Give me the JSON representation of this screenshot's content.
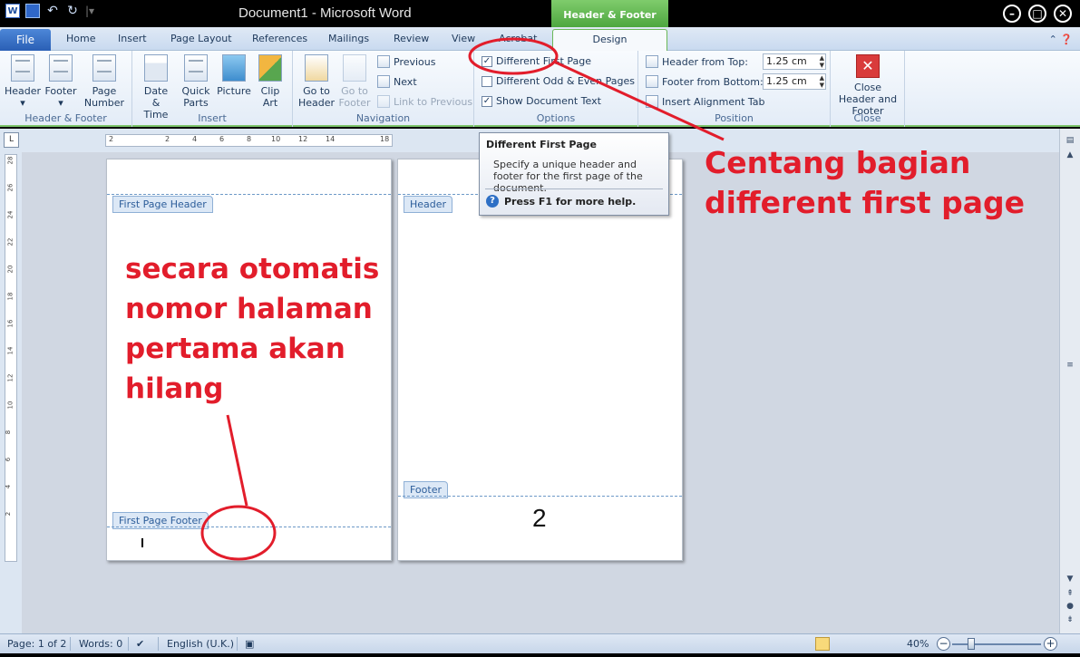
{
  "window": {
    "title": "Document1  -  Microsoft Word",
    "contextual_tab_group": "Header & Footer Tools",
    "controls": [
      "minimize",
      "maximize",
      "close"
    ]
  },
  "qat": {
    "app_icon": "W",
    "icons": [
      "word-icon",
      "save-icon",
      "undo-icon",
      "redo-icon"
    ]
  },
  "tabs": {
    "file": "File",
    "items": [
      "Home",
      "Insert",
      "Page Layout",
      "References",
      "Mailings",
      "Review",
      "View",
      "Acrobat",
      "Design"
    ],
    "active": "Design"
  },
  "ribbon": {
    "header_footer": {
      "header": "Header",
      "footer": "Footer",
      "page_number": "Page Number",
      "label": "Header & Footer"
    },
    "insert": {
      "date_time": "Date & Time",
      "quick_parts": "Quick Parts",
      "picture": "Picture",
      "clip_art": "Clip Art",
      "label": "Insert"
    },
    "navigation": {
      "go_to_header": "Go to Header",
      "go_to_footer": "Go to Footer",
      "previous": "Previous",
      "next": "Next",
      "link_to_previous": "Link to Previous",
      "label": "Navigation"
    },
    "options": {
      "different_first_page": "Different First Page",
      "different_odd_even": "Different Odd & Even Pages",
      "show_document_text": "Show Document Text",
      "label": "Options",
      "checked": [
        true,
        false,
        true
      ]
    },
    "position": {
      "header_from_top": "Header from Top:",
      "header_from_top_value": "1.25 cm",
      "footer_from_bottom": "Footer from Bottom:",
      "footer_from_bottom_value": "1.25 cm",
      "insert_alignment_tab": "Insert Alignment Tab",
      "label": "Position"
    },
    "close": {
      "close_header_footer": "Close Header and Footer",
      "label": "Close"
    }
  },
  "tooltip": {
    "title": "Different First Page",
    "body": "Specify a unique header and footer for the first page of the document.",
    "help": "Press F1 for more help."
  },
  "ruler": {
    "h_ticks": [
      "2",
      "2",
      "4",
      "6",
      "8",
      "10",
      "12",
      "14",
      "18"
    ],
    "v_ticks": [
      "28",
      "26",
      "24",
      "22",
      "20",
      "18",
      "16",
      "14",
      "12",
      "10",
      "8",
      "6",
      "4",
      "2"
    ]
  },
  "pages": {
    "page1": {
      "header_tag": "First Page Header",
      "footer_tag": "First Page Footer"
    },
    "page2": {
      "header_tag": "Header",
      "footer_tag": "Footer",
      "page_number": "2"
    }
  },
  "annotations": {
    "left": [
      "secara otomatis",
      "nomor halaman",
      "pertama akan",
      "hilang"
    ],
    "right": [
      "Centang bagian",
      "different first page"
    ],
    "color": "#e21d2b"
  },
  "statusbar": {
    "page": "Page: 1 of 2",
    "words": "Words: 0",
    "language": "English (U.K.)",
    "zoom": "40%",
    "zoom_level_percent": 40
  }
}
